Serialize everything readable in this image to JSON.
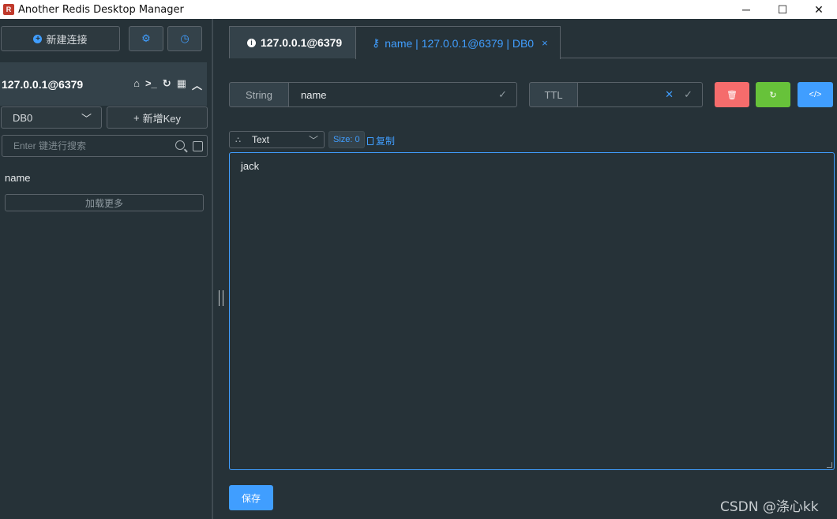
{
  "window": {
    "title": "Another Redis Desktop Manager",
    "controls": {
      "minimize": "─",
      "maximize": "☐",
      "close": "✕"
    }
  },
  "sidebar": {
    "new_connection_label": "新建连接",
    "connection": {
      "name": "127.0.0.1@6379",
      "icons": [
        "home-icon",
        "terminal-icon",
        "refresh-icon",
        "grid-icon",
        "collapse-icon"
      ]
    },
    "db_select": {
      "value": "DB0"
    },
    "new_key_label": "新增Key",
    "search": {
      "placeholder": "Enter 键进行搜索"
    },
    "keys": [
      "name"
    ],
    "load_more_label": "加载更多"
  },
  "tabs": [
    {
      "label": "127.0.0.1@6379",
      "icon": "info-icon",
      "active": false
    },
    {
      "label": "name | 127.0.0.1@6379 | DB0",
      "icon": "key-icon",
      "active": true,
      "close": "×"
    }
  ],
  "key_detail": {
    "type_label": "String",
    "key_name": "name",
    "ttl_label": "TTL",
    "ttl_value": "",
    "format": {
      "value": "Text"
    },
    "size_label": "Size: 0",
    "copy_label": "复制",
    "value": "jack",
    "save_label": "保存"
  },
  "watermark": "CSDN @涤心kk",
  "colors": {
    "background": "#263238",
    "panel": "#34424a",
    "accent": "#409eff",
    "danger": "#f56c6c",
    "success": "#67c23a"
  }
}
